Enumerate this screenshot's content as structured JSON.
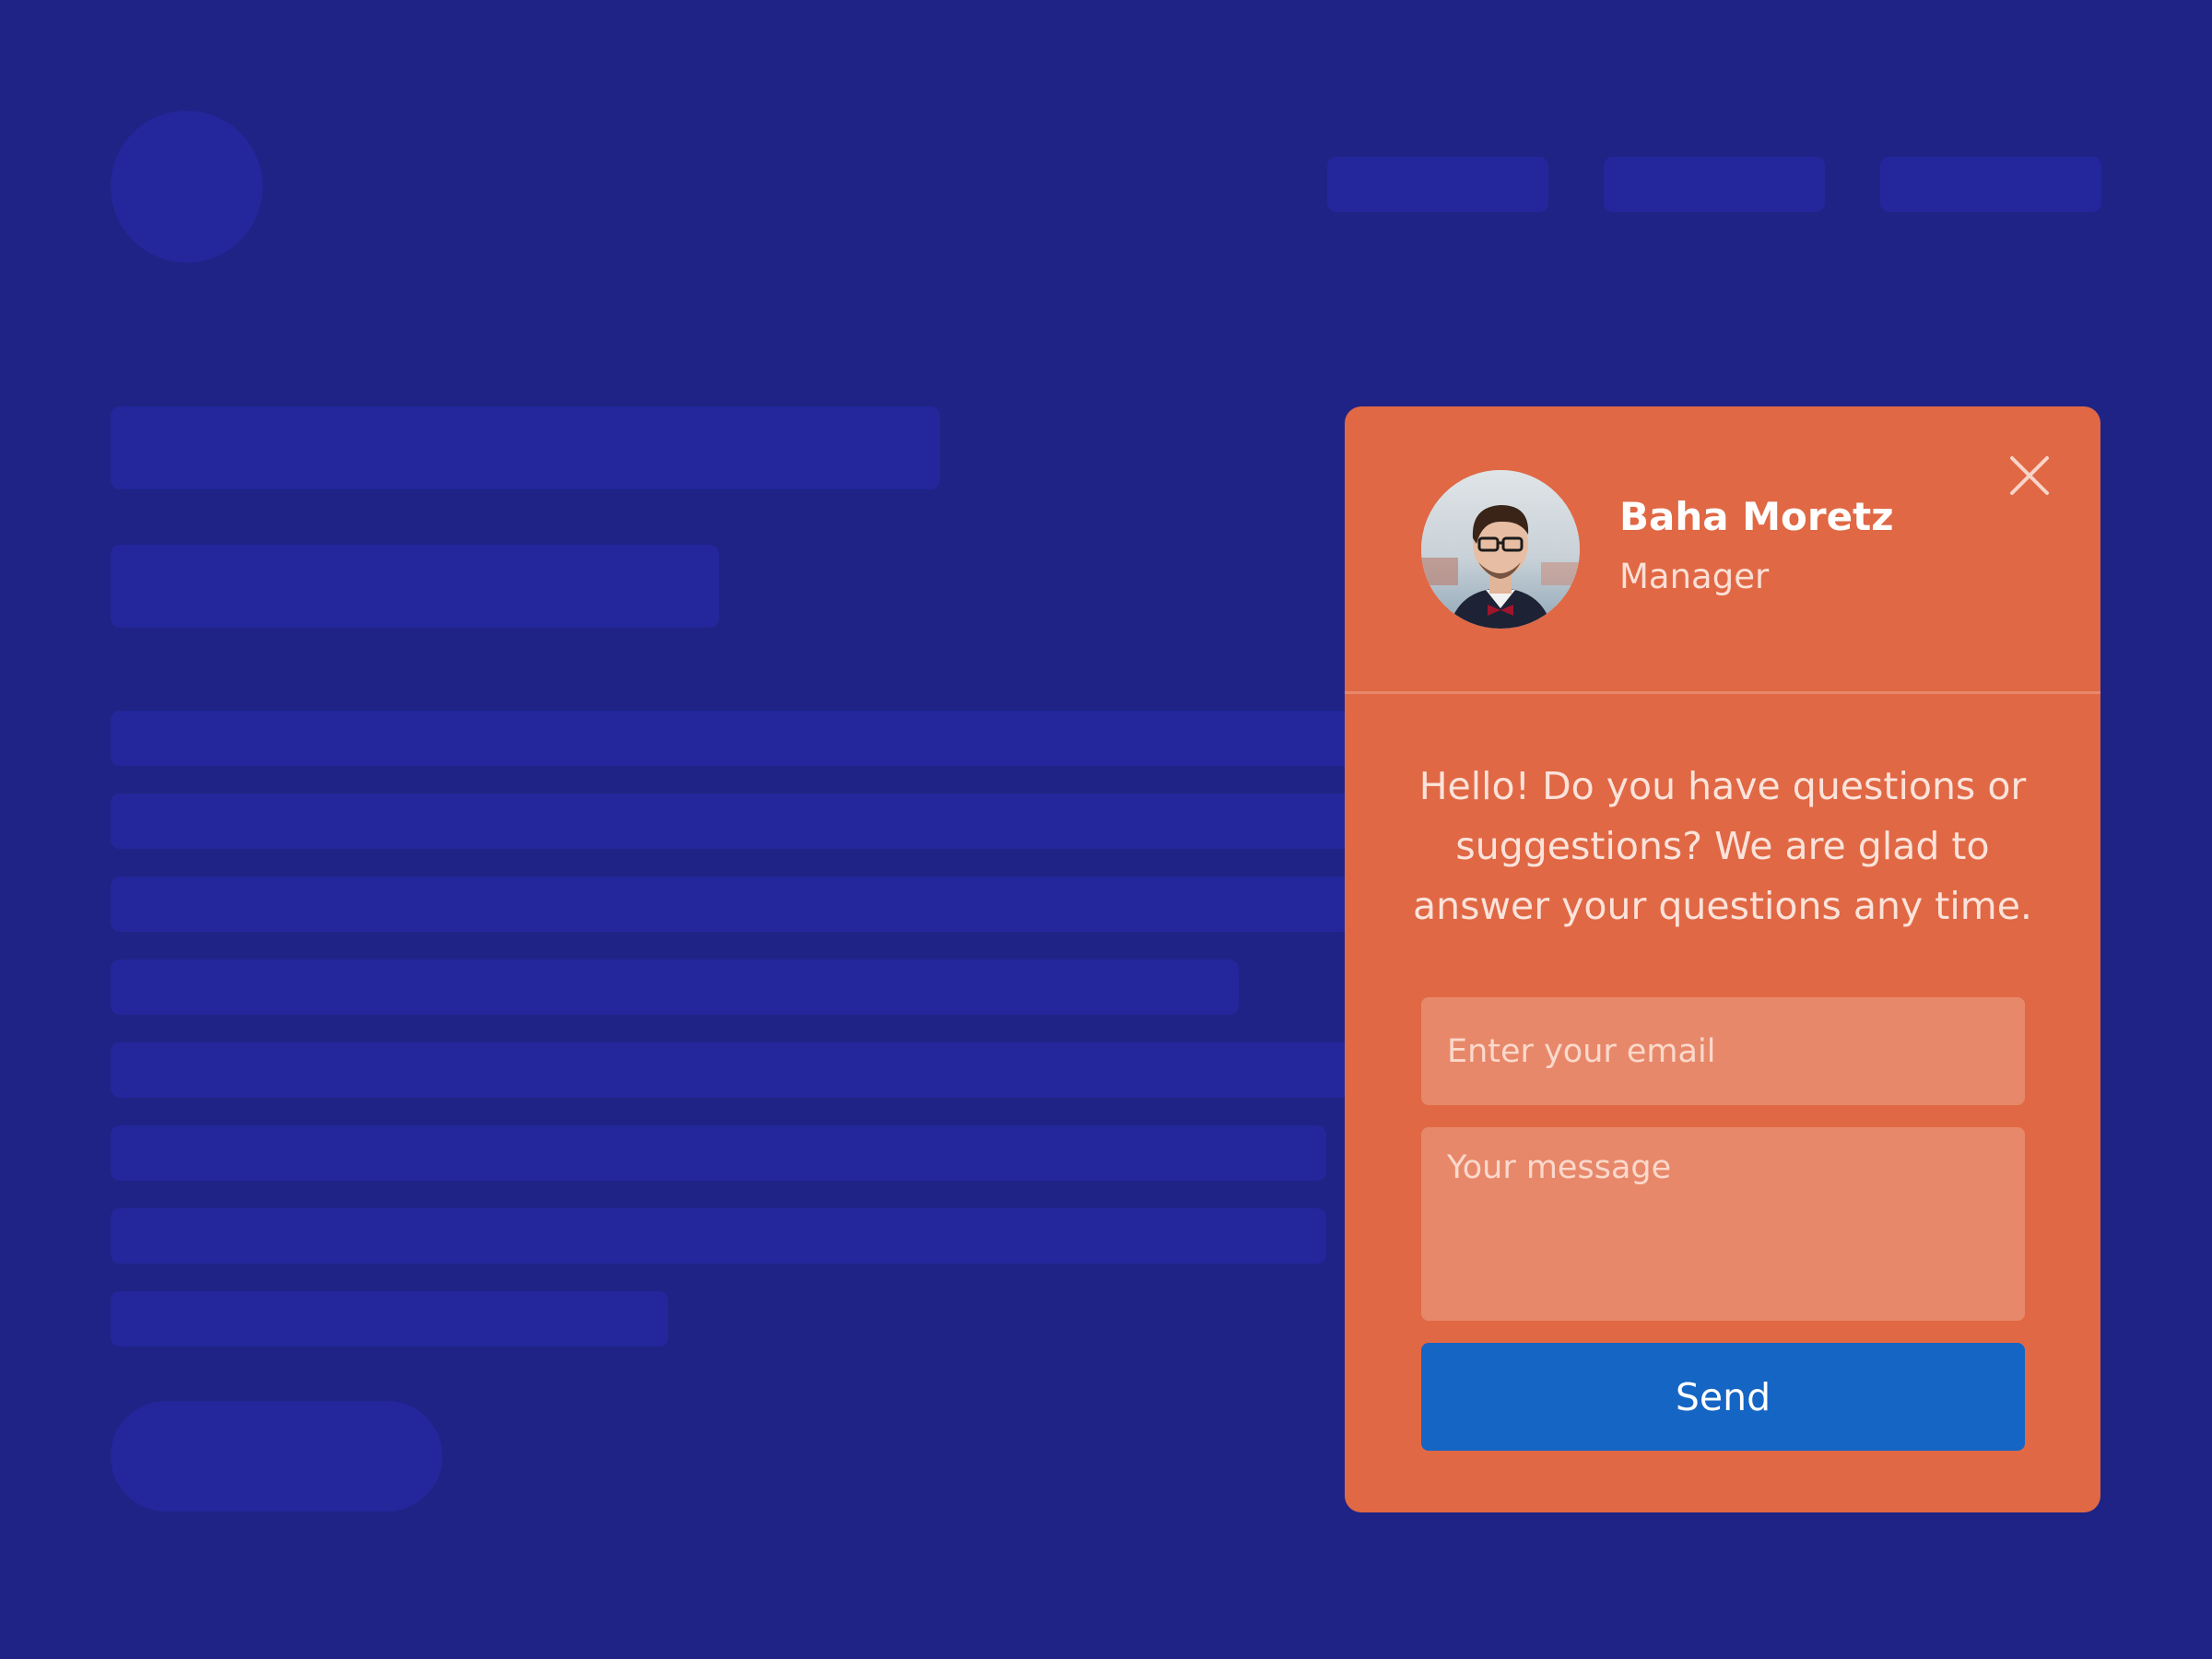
{
  "colors": {
    "background": "#1f2385",
    "placeholder_block": "#23279b",
    "widget": "#e06845",
    "field": "#e8886a",
    "send_button": "#1565c4"
  },
  "chat_widget": {
    "agent": {
      "name": "Baha Moretz",
      "role": "Manager",
      "avatar_icon": "user-avatar-photo"
    },
    "close_icon": "close-icon",
    "greeting": "Hello! Do you have questions or suggestions? We are glad to answer your questions any time.",
    "email_placeholder": "Enter your email",
    "email_value": "",
    "message_placeholder": "Your message",
    "message_value": "",
    "send_label": "Send"
  }
}
